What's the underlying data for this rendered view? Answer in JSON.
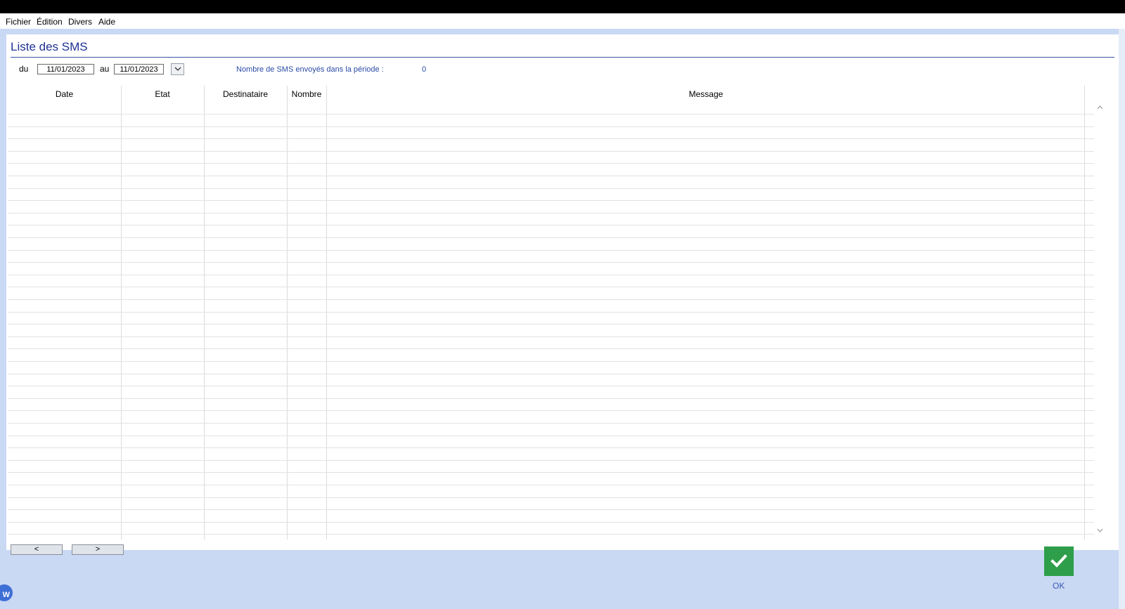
{
  "menu": [
    "Fichier",
    "Édition",
    "Divers",
    "Aide"
  ],
  "page": {
    "title": "Liste des SMS"
  },
  "filter": {
    "from_label": "du",
    "from_date": "11/01/2023",
    "to_label": "au",
    "to_date": "11/01/2023",
    "count_label": "Nombre de SMS envoyés dans la période :",
    "count_value": "0"
  },
  "table": {
    "columns": [
      "Date",
      "Etat",
      "Destinataire",
      "Nombre",
      "Message"
    ],
    "rows": []
  },
  "pagination": {
    "prev_label": "<",
    "next_label": ">"
  },
  "ok": {
    "label": "OK"
  },
  "badge": {
    "letter": "W"
  },
  "colors": {
    "accent": "#1d3393",
    "ok_green": "#2e9e4a",
    "background": "#c9d8f3"
  },
  "icons": [
    "chevron-down-icon",
    "check-icon",
    "scroll-up-icon",
    "scroll-down-icon"
  ]
}
